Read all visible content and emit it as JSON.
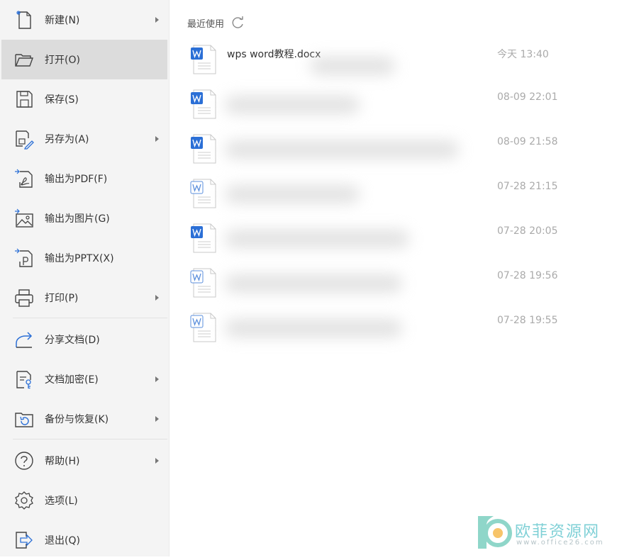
{
  "sidebar": {
    "items": [
      {
        "label": "新建(N)",
        "icon": "new-file-icon",
        "arrow": true
      },
      {
        "label": "打开(O)",
        "icon": "open-folder-icon",
        "arrow": false,
        "active": true
      },
      {
        "label": "保存(S)",
        "icon": "save-icon",
        "arrow": false
      },
      {
        "label": "另存为(A)",
        "icon": "save-as-icon",
        "arrow": true
      },
      {
        "label": "输出为PDF(F)",
        "icon": "export-pdf-icon",
        "arrow": false
      },
      {
        "label": "输出为图片(G)",
        "icon": "export-image-icon",
        "arrow": false
      },
      {
        "label": "输出为PPTX(X)",
        "icon": "export-pptx-icon",
        "arrow": false
      },
      {
        "label": "打印(P)",
        "icon": "printer-icon",
        "arrow": true
      },
      {
        "label": "分享文档(D)",
        "icon": "share-icon",
        "arrow": false
      },
      {
        "label": "文档加密(E)",
        "icon": "encrypt-document-icon",
        "arrow": true
      },
      {
        "label": "备份与恢复(K)",
        "icon": "backup-restore-icon",
        "arrow": true
      },
      {
        "label": "帮助(H)",
        "icon": "help-icon",
        "arrow": true
      },
      {
        "label": "选项(L)",
        "icon": "settings-icon",
        "arrow": false
      },
      {
        "label": "退出(Q)",
        "icon": "exit-icon",
        "arrow": false
      }
    ]
  },
  "main": {
    "recent_title": "最近使用",
    "files": [
      {
        "name": "wps word教程.docx",
        "time": "今天 13:40"
      },
      {
        "name": "",
        "time": "08-09 22:01"
      },
      {
        "name": "",
        "time": "08-09 21:58"
      },
      {
        "name": "",
        "time": "07-28 21:15"
      },
      {
        "name": "",
        "time": "07-28 20:05"
      },
      {
        "name": "",
        "time": "07-28 19:56"
      },
      {
        "name": "",
        "time": "07-28 19:55"
      }
    ]
  },
  "watermark": {
    "title": "欧菲资源网",
    "url": "www.office26.com"
  },
  "colors": {
    "word_blue": "#2b6fd6",
    "sidebar_bg": "#f4f4f4",
    "active_bg": "#dcdcdc",
    "watermark_teal": "#7fd0d6"
  }
}
